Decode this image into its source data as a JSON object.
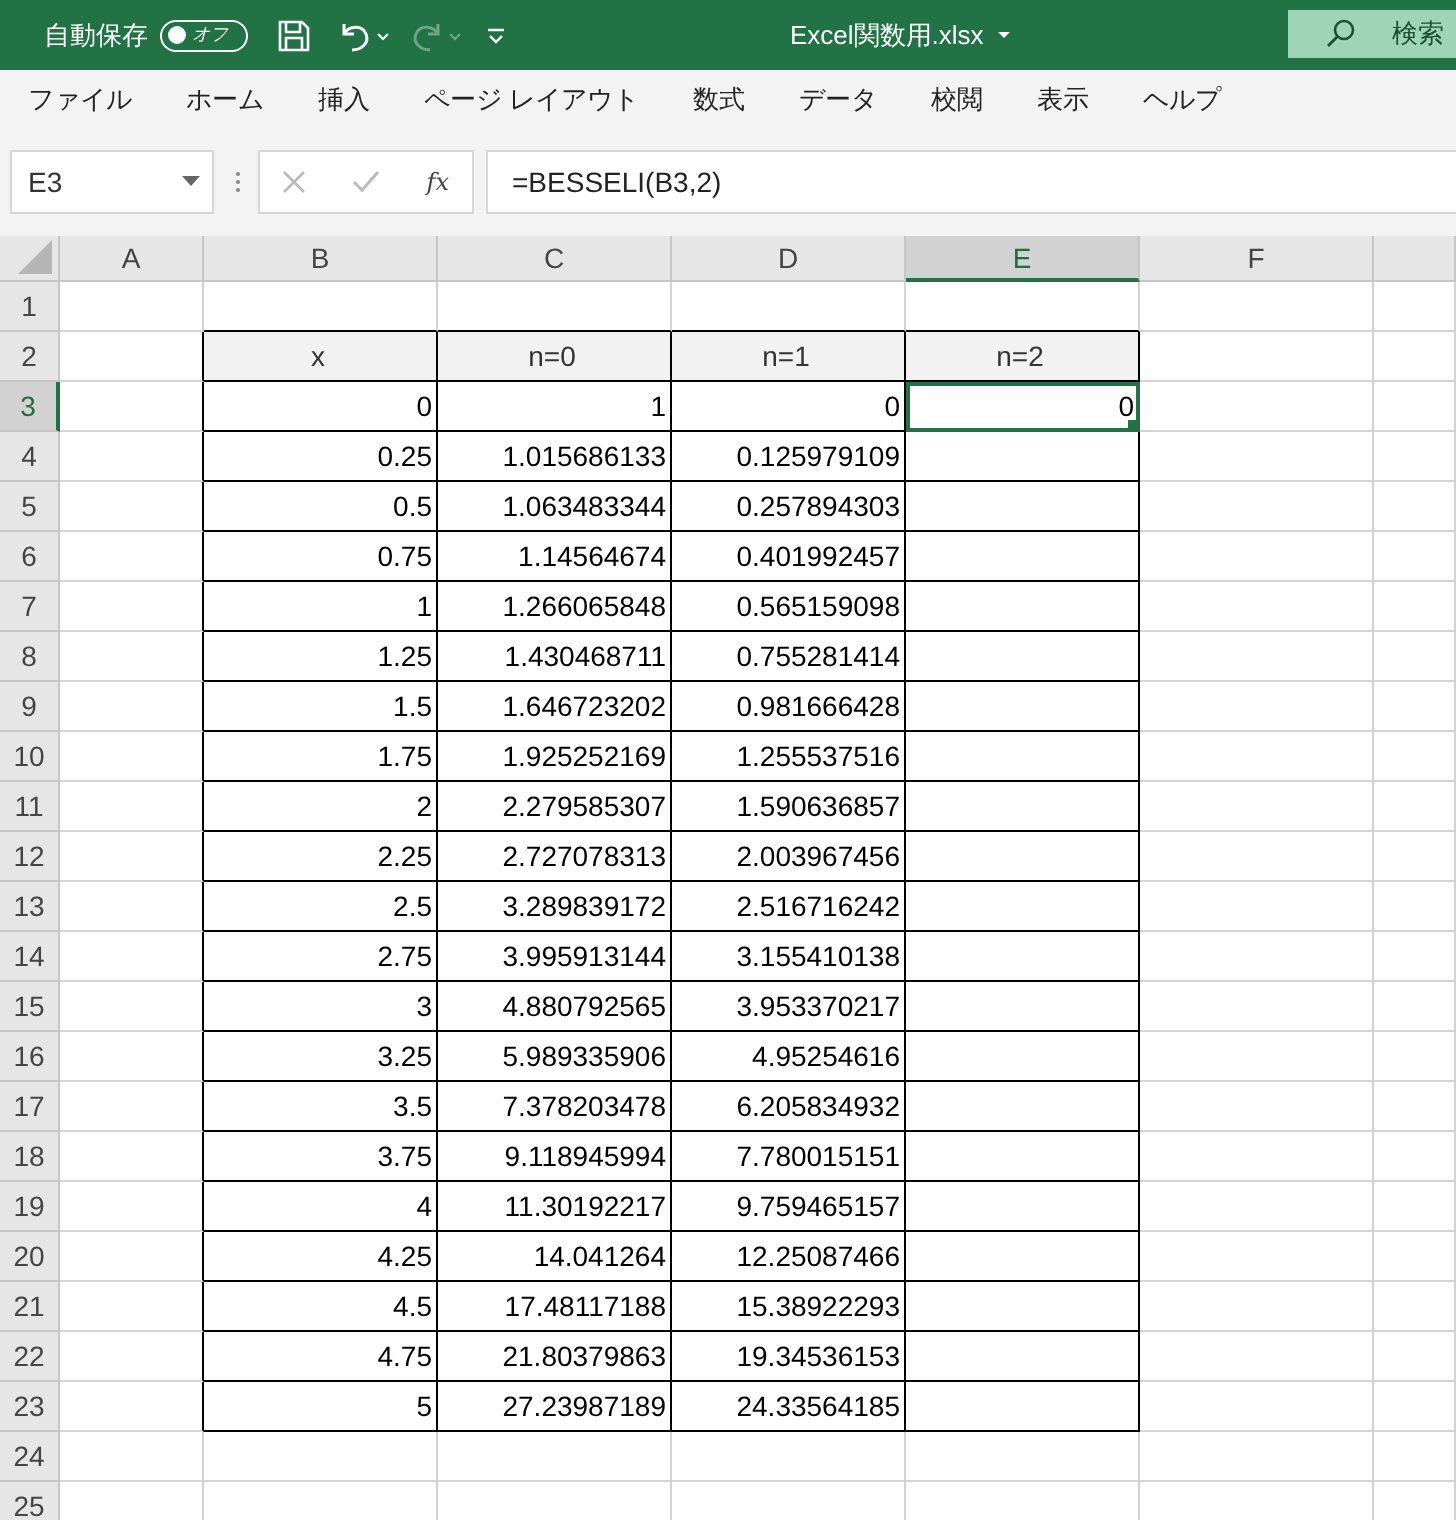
{
  "title_bar": {
    "autosave_label": "自動保存",
    "autosave_toggle": {
      "label": "オフ",
      "on": false
    },
    "redo_disabled": true,
    "filename": "Excel関数用.xlsx",
    "search": "検索"
  },
  "ribbon_tabs": [
    "ファイル",
    "ホーム",
    "挿入",
    "ページ レイアウト",
    "数式",
    "データ",
    "校閲",
    "表示",
    "ヘルプ"
  ],
  "formula_bar": {
    "name_box": "E3",
    "function_label": "fx",
    "formula": "=BESSELI(B3,2)"
  },
  "columns": [
    {
      "label": "A",
      "selected": false
    },
    {
      "label": "B",
      "selected": false
    },
    {
      "label": "C",
      "selected": false
    },
    {
      "label": "D",
      "selected": false
    },
    {
      "label": "E",
      "selected": true
    },
    {
      "label": "F",
      "selected": false
    }
  ],
  "rows": [
    {
      "number": "1",
      "selected": false
    },
    {
      "number": "2",
      "selected": false,
      "kind": "header",
      "values": [
        "x",
        "n=0",
        "n=1",
        "n=2"
      ]
    },
    {
      "number": "3",
      "selected": true,
      "kind": "data",
      "values": [
        "0",
        "1",
        "0",
        "0"
      ]
    },
    {
      "number": "4",
      "selected": false,
      "kind": "data",
      "values": [
        "0.25",
        "1.015686133",
        "0.125979109"
      ]
    },
    {
      "number": "5",
      "selected": false,
      "kind": "data",
      "values": [
        "0.5",
        "1.063483344",
        "0.257894303"
      ]
    },
    {
      "number": "6",
      "selected": false,
      "kind": "data",
      "values": [
        "0.75",
        "1.14564674",
        "0.401992457"
      ]
    },
    {
      "number": "7",
      "selected": false,
      "kind": "data",
      "values": [
        "1",
        "1.266065848",
        "0.565159098"
      ]
    },
    {
      "number": "8",
      "selected": false,
      "kind": "data",
      "values": [
        "1.25",
        "1.430468711",
        "0.755281414"
      ]
    },
    {
      "number": "9",
      "selected": false,
      "kind": "data",
      "values": [
        "1.5",
        "1.646723202",
        "0.981666428"
      ]
    },
    {
      "number": "10",
      "selected": false,
      "kind": "data",
      "values": [
        "1.75",
        "1.925252169",
        "1.255537516"
      ]
    },
    {
      "number": "11",
      "selected": false,
      "kind": "data",
      "values": [
        "2",
        "2.279585307",
        "1.590636857"
      ]
    },
    {
      "number": "12",
      "selected": false,
      "kind": "data",
      "values": [
        "2.25",
        "2.727078313",
        "2.003967456"
      ]
    },
    {
      "number": "13",
      "selected": false,
      "kind": "data",
      "values": [
        "2.5",
        "3.289839172",
        "2.516716242"
      ]
    },
    {
      "number": "14",
      "selected": false,
      "kind": "data",
      "values": [
        "2.75",
        "3.995913144",
        "3.155410138"
      ]
    },
    {
      "number": "15",
      "selected": false,
      "kind": "data",
      "values": [
        "3",
        "4.880792565",
        "3.953370217"
      ]
    },
    {
      "number": "16",
      "selected": false,
      "kind": "data",
      "values": [
        "3.25",
        "5.989335906",
        "4.95254616"
      ]
    },
    {
      "number": "17",
      "selected": false,
      "kind": "data",
      "values": [
        "3.5",
        "7.378203478",
        "6.205834932"
      ]
    },
    {
      "number": "18",
      "selected": false,
      "kind": "data",
      "values": [
        "3.75",
        "9.118945994",
        "7.780015151"
      ]
    },
    {
      "number": "19",
      "selected": false,
      "kind": "data",
      "values": [
        "4",
        "11.30192217",
        "9.759465157"
      ]
    },
    {
      "number": "20",
      "selected": false,
      "kind": "data",
      "values": [
        "4.25",
        "14.041264",
        "12.25087466"
      ]
    },
    {
      "number": "21",
      "selected": false,
      "kind": "data",
      "values": [
        "4.5",
        "17.48117188",
        "15.38922293"
      ]
    },
    {
      "number": "22",
      "selected": false,
      "kind": "data",
      "values": [
        "4.75",
        "21.80379863",
        "19.34536153"
      ]
    },
    {
      "number": "23",
      "selected": false,
      "kind": "data",
      "values": [
        "5",
        "27.23987189",
        "24.33564185"
      ]
    },
    {
      "number": "24",
      "selected": false
    },
    {
      "number": "25",
      "selected": false
    }
  ]
}
